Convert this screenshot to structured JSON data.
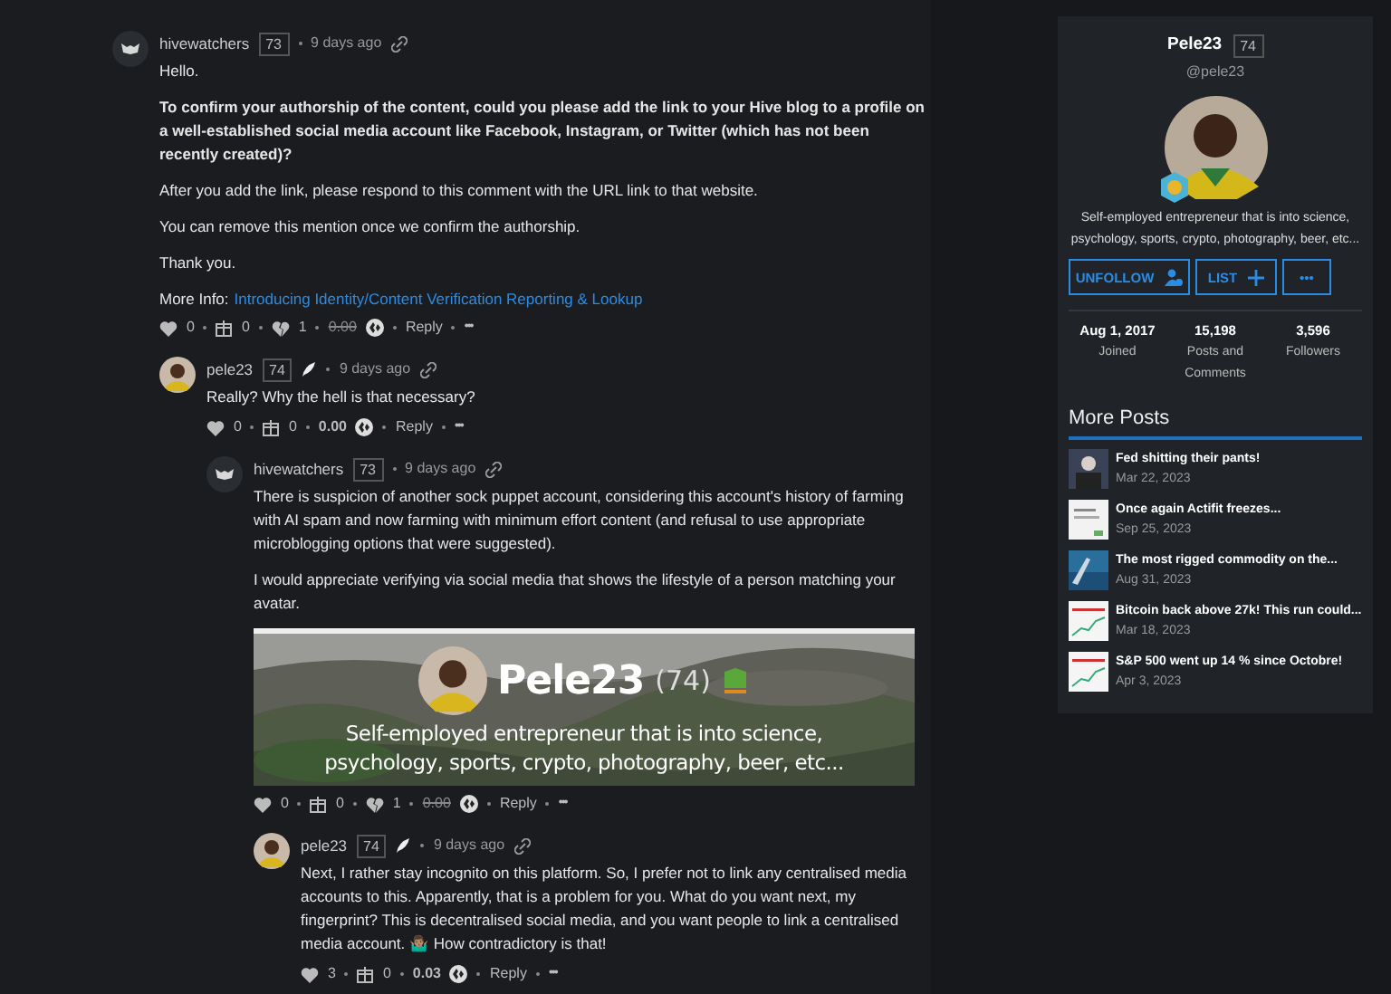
{
  "comments": [
    {
      "author": "hivewatchers",
      "reputation": "73",
      "time": "9 days ago",
      "kind": "owl",
      "author_icon": false,
      "body": [
        {
          "kind": "text",
          "text": "Hello."
        },
        {
          "kind": "bold",
          "text": "To confirm your authorship of the content, could you please add the link to your Hive blog to a profile on a well-established social media account like Facebook, Instagram, or Twitter (which has not been recently created)?"
        },
        {
          "kind": "text",
          "text": "After you add the link, please respond to this comment with the URL link to that website."
        },
        {
          "kind": "text",
          "text": "You can remove this mention once we confirm the authorship."
        },
        {
          "kind": "text",
          "text": "Thank you."
        },
        {
          "kind": "link",
          "prefix": "More Info:",
          "text": "Introducing Identity/Content Verification Reporting & Lookup"
        }
      ],
      "votes": "0",
      "gifts": "0",
      "downvotes": "1",
      "payout": "0.00",
      "payout_struck": true,
      "reply": "Reply",
      "more": "•••",
      "children": [
        {
          "author": "pele23",
          "reputation": "74",
          "time": "9 days ago",
          "kind": "person",
          "author_icon": true,
          "body": [
            {
              "kind": "text",
              "text": "Really? Why the hell is that necessary?"
            }
          ],
          "votes": "0",
          "gifts": "0",
          "payout": "0.00",
          "payout_struck": false,
          "reply": "Reply",
          "more": "•••",
          "children": [
            {
              "author": "hivewatchers",
              "reputation": "73",
              "time": "9 days ago",
              "kind": "owl",
              "author_icon": false,
              "body": [
                {
                  "kind": "text",
                  "text": "There is suspicion of another sock puppet account, considering this account's history of farming with AI spam and now farming with minimum effort content (and refusal to use appropriate microblogging options that were suggested)."
                },
                {
                  "kind": "text",
                  "text": "I would appreciate verifying via social media that shows the lifestyle of a person matching your avatar."
                },
                {
                  "kind": "banner",
                  "name": "Pele23",
                  "reputation": "(74)",
                  "bio": "Self-employed entrepreneur that is into science, psychology, sports, crypto, photography, beer, etc..."
                }
              ],
              "votes": "0",
              "gifts": "0",
              "downvotes": "1",
              "payout": "0.00",
              "payout_struck": true,
              "reply": "Reply",
              "more": "•••",
              "children": [
                {
                  "author": "pele23",
                  "reputation": "74",
                  "time": "9 days ago",
                  "kind": "person",
                  "author_icon": true,
                  "body": [
                    {
                      "kind": "text",
                      "text": "Next, I rather stay incognito on this platform. So, I prefer not to link any centralised media accounts to this. Apparently, that is a problem for you. What do you want next, my fingerprint? This is decentralised social media, and you want people to link a centralised media account. 🤷🏽‍♂️ How contradictory is that!"
                    }
                  ],
                  "votes": "3",
                  "gifts": "0",
                  "payout": "0.03",
                  "payout_struck": false,
                  "reply": "Reply",
                  "more": "•••"
                }
              ]
            }
          ]
        }
      ]
    }
  ],
  "profile": {
    "name": "Pele23",
    "reputation": "74",
    "handle": "@pele23",
    "bio": "Self-employed entrepreneur that is into science, psychology, sports, crypto, photography, beer, etc...",
    "buttons": [
      {
        "kind": "unfollow",
        "label": "UNFOLLOW"
      },
      {
        "kind": "list",
        "label": "LIST"
      },
      {
        "kind": "more",
        "label": "•••"
      }
    ],
    "stats": [
      {
        "value": "Aug 1, 2017",
        "label": "Joined"
      },
      {
        "value": "15,198",
        "label": "Posts and Comments"
      },
      {
        "value": "3,596",
        "label": "Followers"
      }
    ]
  },
  "more_posts": {
    "title": "More Posts",
    "posts": [
      {
        "title": "Fed shitting their pants!",
        "date": "Mar 22, 2023",
        "kind": "person"
      },
      {
        "title": "Once again Actifit freezes...",
        "date": "Sep 25, 2023",
        "kind": "doc"
      },
      {
        "title": "The most rigged commodity on the...",
        "date": "Aug 31, 2023",
        "kind": "water"
      },
      {
        "title": "Bitcoin back above 27k! This run could...",
        "date": "Mar 18, 2023",
        "kind": "chart"
      },
      {
        "title": "S&P 500 went up 14 % since Octobre!",
        "date": "Apr 3, 2023",
        "kind": "chart"
      }
    ]
  }
}
